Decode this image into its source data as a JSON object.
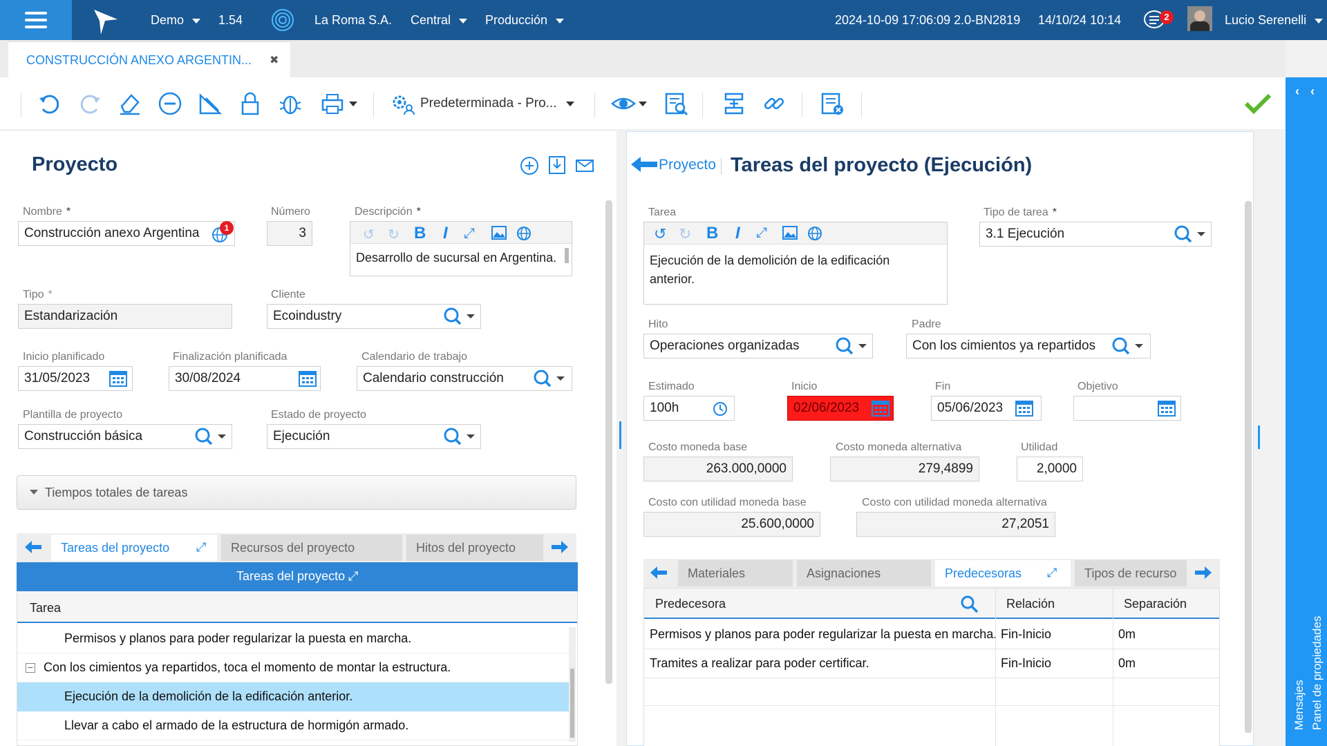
{
  "topbar": {
    "env": "Demo",
    "version": "1.54",
    "company": "La Roma S.A.",
    "branch": "Central",
    "mode": "Producción",
    "build": "2024-10-09 17:06:09 2.0-BN2819",
    "datetime": "14/10/24 10:14",
    "notifications": "2",
    "user": "Lucio Serenelli"
  },
  "doc_tab": {
    "title": "CONSTRUCCIÓN ANEXO ARGENTIN...",
    "close": "✖"
  },
  "toolbar": {
    "view_label": "Predeterminada - Pro..."
  },
  "left": {
    "title": "Proyecto",
    "nombre_label": "Nombre",
    "nombre": "Construcción anexo Argentina",
    "nombre_badge": "1",
    "numero_label": "Número",
    "numero": "3",
    "descripcion_label": "Descripción",
    "descripcion": "Desarrollo de sucursal en Argentina.",
    "tipo_label": "Tipo",
    "tipo": "Estandarización",
    "cliente_label": "Cliente",
    "cliente": "Ecoindustry",
    "inicio_label": "Inicio planificado",
    "inicio": "31/05/2023",
    "fin_label": "Finalización planificada",
    "fin": "30/08/2024",
    "calendario_label": "Calendario de trabajo",
    "calendario": "Calendario construcción",
    "plantilla_label": "Plantilla de proyecto",
    "plantilla": "Construcción básica",
    "estado_label": "Estado de proyecto",
    "estado": "Ejecución",
    "collapse": "Tiempos totales de tareas",
    "tabs": [
      "Tareas del proyecto",
      "Recursos del proyecto",
      "Hitos del proyecto"
    ],
    "grid_title": "Tareas del proyecto",
    "grid_col": "Tarea",
    "rows": [
      "Permisos y planos para poder regularizar la puesta en marcha.",
      "Con los cimientos ya repartidos, toca el momento de montar la estructura.",
      "Ejecución de la demolición de la edificación anterior.",
      "Llevar a cabo el armado de la estructura de hormigón armado."
    ]
  },
  "right": {
    "back_label": "Proyecto",
    "title": "Tareas del proyecto (Ejecución)",
    "tarea_label": "Tarea",
    "tarea_line1": "Ejecución de la demolición de la edificación",
    "tarea_line2": "anterior.",
    "tipo_tarea_label": "Tipo de tarea",
    "tipo_tarea": "3.1 Ejecución",
    "hito_label": "Hito",
    "hito": "Operaciones organizadas",
    "padre_label": "Padre",
    "padre": "Con los cimientos ya repartidos",
    "estimado_label": "Estimado",
    "estimado": "100h",
    "inicio_label": "Inicio",
    "inicio": "02/06/2023",
    "fin_label": "Fin",
    "fin": "05/06/2023",
    "objetivo_label": "Objetivo",
    "costo_base_label": "Costo moneda base",
    "costo_base": "263.000,0000",
    "costo_alt_label": "Costo moneda alternativa",
    "costo_alt": "279,4899",
    "utilidad_label": "Utilidad",
    "utilidad": "2,0000",
    "cu_base_label": "Costo con utilidad moneda base",
    "cu_base": "25.600,0000",
    "cu_alt_label": "Costo con utilidad moneda alternativa",
    "cu_alt": "27,2051",
    "tabs": [
      "Materiales",
      "Asignaciones",
      "Predecesoras",
      "Tipos de recurso"
    ],
    "grid_cols": [
      "Predecesora",
      "Relación",
      "Separación"
    ],
    "rows": [
      {
        "pred": "Permisos y planos para poder regularizar la puesta en marcha.",
        "rel": "Fin-Inicio",
        "sep": "0m"
      },
      {
        "pred": "Tramites a realizar para poder certificar.",
        "rel": "Fin-Inicio",
        "sep": "0m"
      }
    ]
  },
  "rail": {
    "mensajes": "Mensajes",
    "panel": "Panel de propiedades"
  },
  "colors": {
    "topbar": "#1a5893",
    "accent": "#2196f3",
    "title": "#1a3c66",
    "selected_row": "#aee0fb",
    "error": "#ff1a1a",
    "save": "#5cb82e"
  }
}
